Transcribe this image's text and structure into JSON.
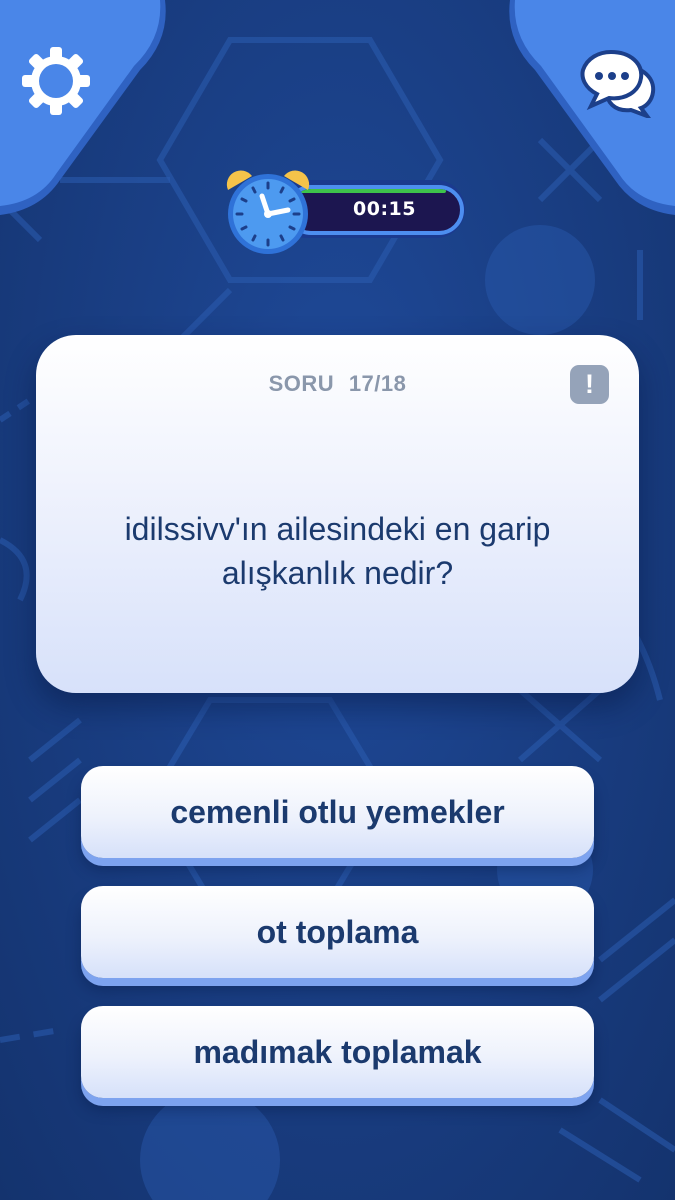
{
  "timer": {
    "time": "00:15",
    "progress": 0.92
  },
  "question": {
    "label": "SORU",
    "counter": "17/18",
    "text": "idilssivv'ın ailesindeki en garip alışkanlık nedir?",
    "report_symbol": "!"
  },
  "answers": [
    {
      "label": "cemenli otlu yemekler"
    },
    {
      "label": "ot toplama"
    },
    {
      "label": "madımak toplamak"
    }
  ],
  "icons": {
    "settings": "gear-icon",
    "chat": "chat-bubbles-icon",
    "timer": "alarm-clock-icon"
  },
  "colors": {
    "background": "#1a3f85",
    "corner_tab": "#4a86e8",
    "card_text": "#1b3a6e",
    "timer_bar": "#3ec24b",
    "answer_shadow": "#7da3ef"
  }
}
